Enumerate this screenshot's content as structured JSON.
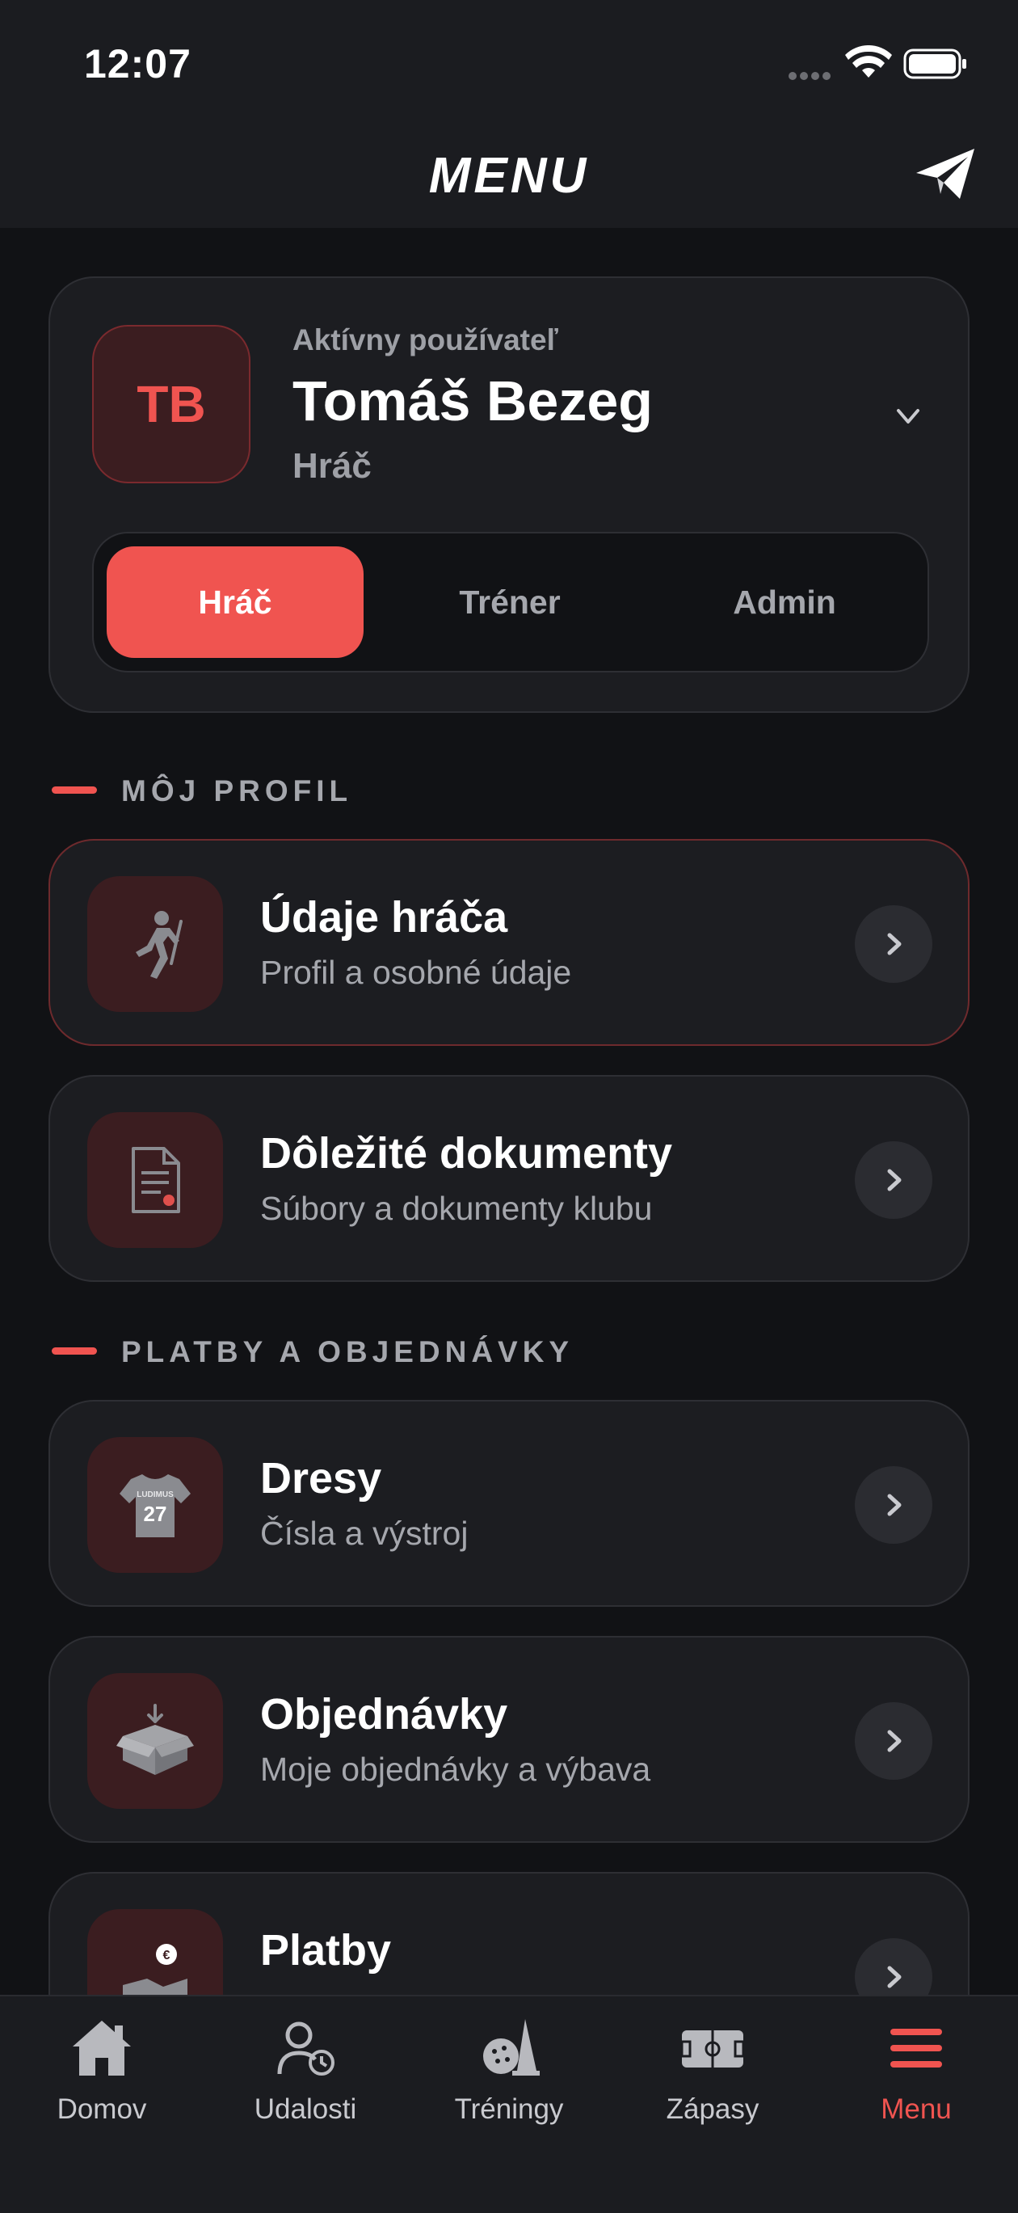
{
  "status_bar": {
    "time": "12:07"
  },
  "header": {
    "title": "MENU"
  },
  "user_card": {
    "caption": "Aktívny používateľ",
    "initials": "TB",
    "name": "Tomáš Bezeg",
    "role": "Hráč"
  },
  "role_switcher": {
    "options": [
      "Hráč",
      "Tréner",
      "Admin"
    ],
    "selected": "Hráč"
  },
  "sections": [
    {
      "title": "MÔJ PROFIL",
      "items": [
        {
          "title": "Údaje hráča",
          "subtitle": "Profil a osobné údaje",
          "icon": "player-running-icon"
        },
        {
          "title": "Dôležité dokumenty",
          "subtitle": "Súbory a dokumenty klubu",
          "icon": "document-icon"
        }
      ]
    },
    {
      "title": "PLATBY A OBJEDNÁVKY",
      "items": [
        {
          "title": "Dresy",
          "subtitle": "Čísla a výstroj",
          "icon": "jersey-icon",
          "jersey_text": "LUDIMUS",
          "jersey_number": "27"
        },
        {
          "title": "Objednávky",
          "subtitle": "Moje objednávky a výbava",
          "icon": "box-icon"
        },
        {
          "title": "Platby",
          "subtitle": "",
          "icon": "payment-icon"
        }
      ]
    }
  ],
  "tab_bar": {
    "tabs": [
      {
        "label": "Domov",
        "icon": "home-icon"
      },
      {
        "label": "Udalosti",
        "icon": "events-icon"
      },
      {
        "label": "Tréningy",
        "icon": "training-icon"
      },
      {
        "label": "Zápasy",
        "icon": "court-icon"
      },
      {
        "label": "Menu",
        "icon": "menu-icon"
      }
    ],
    "active": "Menu"
  },
  "colors": {
    "accent": "#f05450",
    "background": "#111215",
    "card": "#1c1d21",
    "icon_tile": "#3b1d20",
    "muted_text": "#a5a7ad"
  }
}
